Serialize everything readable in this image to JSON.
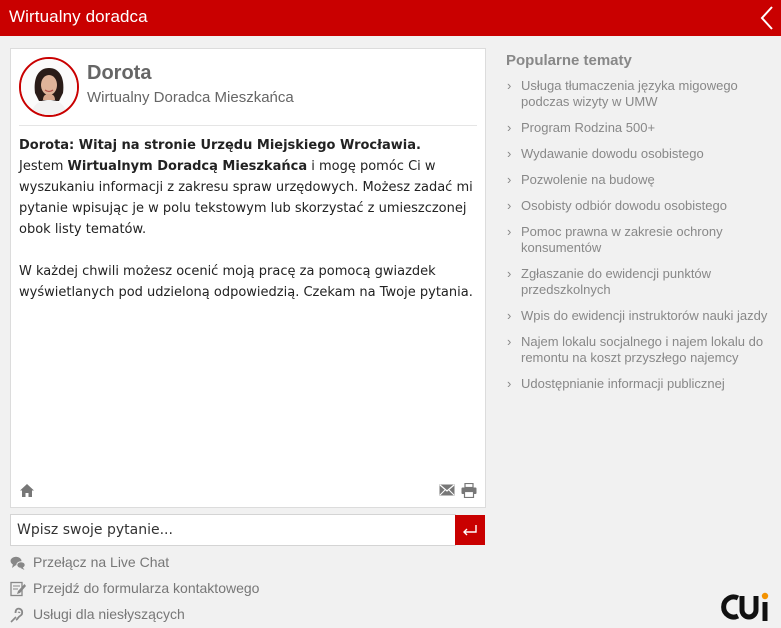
{
  "header": {
    "title": "Wirtualny doradca"
  },
  "agent": {
    "name": "Dorota",
    "role": "Wirtualny Doradca Mieszkańca"
  },
  "messages": {
    "greeting_prefix": "Dorota: ",
    "greeting_bold": "Witaj na stronie Urzędu Miejskiego Wrocławia.",
    "line1_before": "Jestem ",
    "line1_bold": "Wirtualnym Doradcą Mieszkańca",
    "line1_after": " i mogę pomóc Ci w wyszukaniu informacji z zakresu spraw urzędowych. Możesz zadać mi pytanie wpisując je w polu tekstowym lub skorzystać z umieszczonej obok listy tematów.",
    "line2": "W każdej chwili możesz ocenić moją pracę za pomocą gwiazdek wyświetlanych pod udzieloną odpowiedzią. Czekam na Twoje pytania."
  },
  "input": {
    "placeholder": "Wpisz swoje pytanie..."
  },
  "links": [
    {
      "label": "Przełącz na Live Chat",
      "icon": "speech-bubbles-icon"
    },
    {
      "label": "Przejdź do formularza kontaktowego",
      "icon": "form-edit-icon"
    },
    {
      "label": "Usługi dla niesłyszących",
      "icon": "deaf-ear-icon"
    }
  ],
  "popular": {
    "heading": "Popularne tematy",
    "items": [
      "Usługa tłumaczenia języka migowego podczas wizyty w UMW",
      "Program Rodzina 500+",
      "Wydawanie dowodu osobistego",
      "Pozwolenie na budowę",
      "Osobisty odbiór dowodu osobistego",
      "Pomoc prawna w zakresie ochrony konsumentów",
      "Zgłaszanie do ewidencji punktów przedszkolnych",
      "Wpis do ewidencji instruktorów nauki jazdy",
      "Najem lokalu socjalnego i najem lokalu do remontu na koszt przyszłego najemcy",
      "Udostępnianie informacji publicznej"
    ]
  },
  "logo": {
    "text": "CUi"
  },
  "colors": {
    "accent": "#c90000",
    "muted_text": "#888888",
    "logo_orange": "#f39200"
  }
}
